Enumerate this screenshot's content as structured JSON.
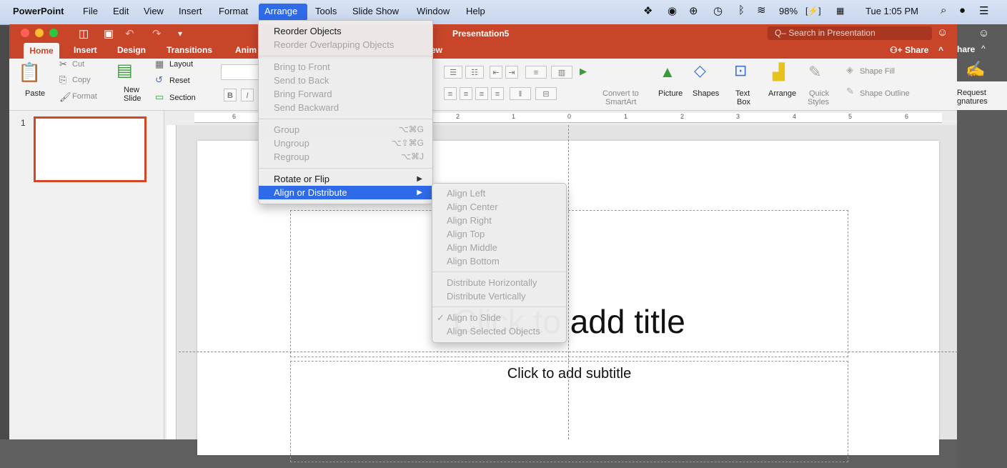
{
  "menubar": {
    "app_name": "PowerPoint",
    "items": [
      "File",
      "Edit",
      "View",
      "Insert",
      "Format",
      "Arrange",
      "Tools",
      "Slide Show",
      "Window",
      "Help"
    ],
    "active_item": "Arrange",
    "battery": "98%",
    "clock": "Tue 1:05 PM"
  },
  "window": {
    "document_title": "Presentation5",
    "search_placeholder": "Q– Search in Presentation",
    "share_label": "Share",
    "share_label_clipped": "hare"
  },
  "ribbon": {
    "tabs": [
      "Home",
      "Insert",
      "Design",
      "Transitions",
      "Anim"
    ],
    "tab_partial": "ew",
    "active_tab": "Home",
    "clipboard": {
      "paste": "Paste",
      "cut": "Cut",
      "copy": "Copy",
      "format": "Format"
    },
    "slides": {
      "new_slide_line1": "New",
      "new_slide_line2": "Slide",
      "layout": "Layout",
      "reset": "Reset",
      "section": "Section"
    },
    "font_buttons": {
      "bold": "B",
      "italic": "I"
    },
    "convert_line1": "Convert to",
    "convert_line2": "SmartArt",
    "picture": "Picture",
    "shapes": "Shapes",
    "text_box_line1": "Text",
    "text_box_line2": "Box",
    "arrange": "Arrange",
    "quick_styles_line1": "Quick",
    "quick_styles_line2": "Styles",
    "shape_fill": "Shape Fill",
    "shape_outline": "Shape Outline",
    "request_line1": "Request",
    "request_line2": "gnatures"
  },
  "thumbnail": {
    "number": "1"
  },
  "ruler": {
    "h_ticks": [
      "6",
      "2",
      "1",
      "0",
      "1",
      "2",
      "3",
      "4",
      "5",
      "6"
    ]
  },
  "slide": {
    "title": "Click to add title",
    "subtitle": "Click to add subtitle"
  },
  "arrange_menu": {
    "items": [
      {
        "label": "Reorder Objects",
        "enabled": true
      },
      {
        "label": "Reorder Overlapping Objects",
        "enabled": false
      },
      {
        "label": "Bring to Front",
        "enabled": false
      },
      {
        "label": "Send to Back",
        "enabled": false
      },
      {
        "label": "Bring Forward",
        "enabled": false
      },
      {
        "label": "Send Backward",
        "enabled": false
      },
      {
        "label": "Group",
        "shortcut": "⌥⌘G",
        "enabled": false
      },
      {
        "label": "Ungroup",
        "shortcut": "⌥⇧⌘G",
        "enabled": false
      },
      {
        "label": "Regroup",
        "shortcut": "⌥⌘J",
        "enabled": false
      },
      {
        "label": "Rotate or Flip",
        "enabled": true
      },
      {
        "label": "Align or Distribute",
        "enabled": true,
        "highlighted": true
      }
    ]
  },
  "align_menu": {
    "items": [
      {
        "label": "Align Left"
      },
      {
        "label": "Align Center"
      },
      {
        "label": "Align Right"
      },
      {
        "label": "Align Top"
      },
      {
        "label": "Align Middle"
      },
      {
        "label": "Align Bottom"
      },
      {
        "label": "Distribute Horizontally"
      },
      {
        "label": "Distribute Vertically"
      },
      {
        "label": "Align to Slide",
        "checked": true
      },
      {
        "label": "Align Selected Objects"
      }
    ]
  },
  "colors": {
    "accent": "#c8452a",
    "highlight": "#2f6ae8"
  }
}
